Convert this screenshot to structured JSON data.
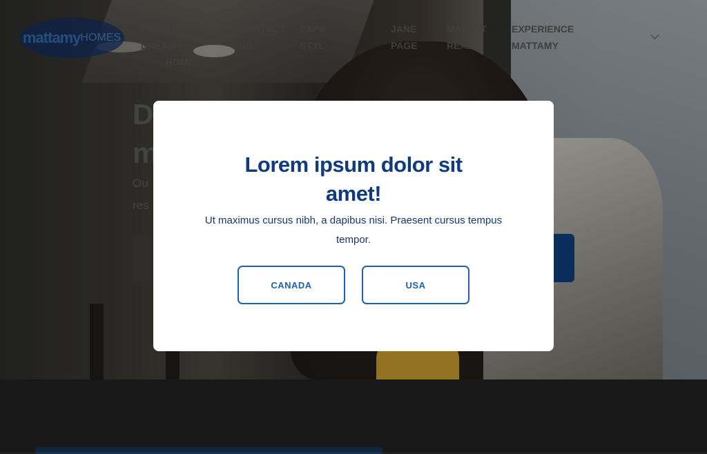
{
  "brand": {
    "logo_primary": "mattamy",
    "logo_secondary": "HOMES",
    "accent_color": "#1d5fb0",
    "title_color": "#0f3a7c"
  },
  "nav": {
    "items": [
      {
        "line1": "FIND YOUR DREAM",
        "line2": "HOME"
      },
      {
        "line1": "CONTACT",
        "line2": "US"
      },
      {
        "line1": "EXPR",
        "line2": "STYL"
      },
      {
        "line1": "JANE",
        "line2": "PAGE"
      },
      {
        "line1": "MAKE IT",
        "line2": "REAL"
      },
      {
        "line1": "EXPERIENCE",
        "line2": "MATTAMY"
      }
    ],
    "dropdown_icon": "chevron-down-icon"
  },
  "hero": {
    "title_line1": "DI",
    "title_line2": "m",
    "sub_line1": "Ou",
    "sub_line2": "res"
  },
  "modal": {
    "title_line1": "Lorem ipsum dolor sit",
    "title_line2": "amet!",
    "text": "Ut maximus cursus nibh, a dapibus nisi. Praesent cursus tempus tempor.",
    "buttons": {
      "canada": "CANADA",
      "usa": "USA"
    }
  }
}
